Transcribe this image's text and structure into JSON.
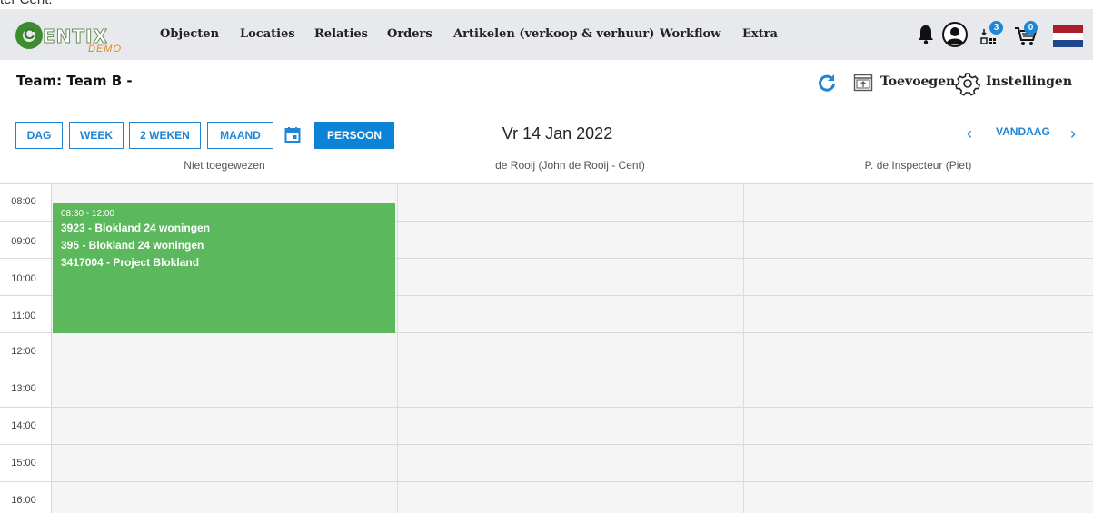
{
  "stray_text": "ter Cent.",
  "logo": {
    "text": "ENTIX",
    "letter": "C",
    "sub": "DEMO"
  },
  "nav": {
    "items": [
      "Objecten",
      "Locaties",
      "Relaties",
      "Orders",
      "Artikelen (verkoop & verhuur)",
      "Workflow",
      "Extra"
    ],
    "badges": {
      "tasks": "3",
      "cart": "0"
    },
    "icons": [
      "bell-icon",
      "user-icon",
      "tasks-icon",
      "cart-icon",
      "flag-nl-icon"
    ]
  },
  "header": {
    "title": "Team: Team B -",
    "add_label": "Toevoegen",
    "settings_label": "Instellingen"
  },
  "toolbar": {
    "views": [
      "DAG",
      "WEEK",
      "2 WEKEN",
      "MAAND"
    ],
    "person_label": "PERSOON",
    "date": "Vr 14 Jan 2022",
    "today_label": "VANDAAG",
    "prev_icon": "‹",
    "next_icon": "›"
  },
  "columns": [
    "Niet toegewezen",
    "de Rooij (John de Rooij - Cent)",
    "P. de Inspecteur (Piet)"
  ],
  "times": [
    "08:00",
    "09:00",
    "10:00",
    "11:00",
    "12:00",
    "13:00",
    "14:00",
    "15:00",
    "16:00"
  ],
  "event": {
    "time": "08:30 - 12:00",
    "lines": [
      "3923 - Blokland 24 woningen",
      "395 - Blokland 24 woningen",
      "3417004 - Project Blokland"
    ]
  },
  "colors": {
    "accent": "#0b84d8",
    "event_green": "#5cb85c",
    "now_line": "#f0a070",
    "nav_bg": "#e7e9ec"
  }
}
